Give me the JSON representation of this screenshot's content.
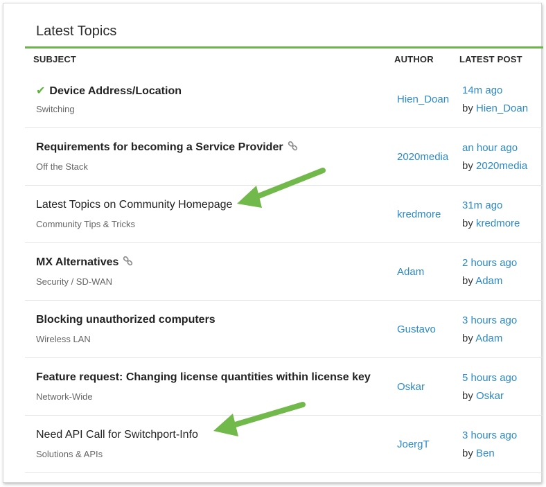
{
  "panel": {
    "title": "Latest Topics",
    "columns": {
      "subject": "SUBJECT",
      "author": "AUTHOR",
      "latest_post": "LATEST POST"
    }
  },
  "topics": [
    {
      "subject": "Device Address/Location",
      "category": "Switching",
      "author": "Hien_Doan",
      "time": "14m ago",
      "by_prefix": "by",
      "by_user": "Hien_Doan",
      "solved": true,
      "linked": false
    },
    {
      "subject": "Requirements for becoming a Service Provider",
      "category": "Off the Stack",
      "author": "2020media",
      "time": "an hour ago",
      "by_prefix": "by",
      "by_user": "2020media",
      "solved": false,
      "linked": true
    },
    {
      "subject": "Latest Topics on Community Homepage",
      "category": "Community Tips & Tricks",
      "author": "kredmore",
      "time": "31m ago",
      "by_prefix": "by",
      "by_user": "kredmore",
      "solved": false,
      "linked": false
    },
    {
      "subject": "MX Alternatives",
      "category": "Security / SD-WAN",
      "author": "Adam",
      "time": "2 hours ago",
      "by_prefix": "by",
      "by_user": "Adam",
      "solved": false,
      "linked": true
    },
    {
      "subject": "Blocking unauthorized computers",
      "category": "Wireless LAN",
      "author": "Gustavo",
      "time": "3 hours ago",
      "by_prefix": "by",
      "by_user": "Adam",
      "solved": false,
      "linked": false
    },
    {
      "subject": "Feature request: Changing license quantities within license key",
      "category": "Network-Wide",
      "author": "Oskar",
      "time": "5 hours ago",
      "by_prefix": "by",
      "by_user": "Oskar",
      "solved": false,
      "linked": false
    },
    {
      "subject": "Need API Call for Switchport-Info",
      "category": "Solutions & APIs",
      "author": "JoergT",
      "time": "3 hours ago",
      "by_prefix": "by",
      "by_user": "Ben",
      "solved": false,
      "linked": false
    }
  ],
  "colors": {
    "accent_green": "#69b54a",
    "link_blue": "#2d8ac7",
    "annotation_arrow": "#72b94b"
  }
}
